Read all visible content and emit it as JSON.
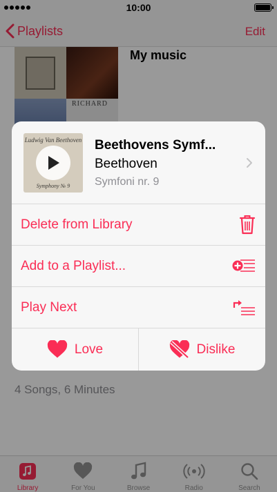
{
  "status_bar": {
    "time": "10:00"
  },
  "nav": {
    "back_label": "Playlists",
    "edit_label": "Edit"
  },
  "playlist": {
    "title": "My music",
    "art_text": "RICHARD",
    "songs_info": "4 Songs, 6 Minutes"
  },
  "sheet": {
    "title": "Beethovens Symf...",
    "artist": "Beethoven",
    "album": "Symfoni nr. 9",
    "actions": {
      "delete": "Delete from Library",
      "add_playlist": "Add to a Playlist...",
      "play_next": "Play Next"
    },
    "love": "Love",
    "dislike": "Dislike"
  },
  "tabs": [
    {
      "label": "Library",
      "icon": "music-note-square-icon",
      "active": true
    },
    {
      "label": "For You",
      "icon": "heart-icon"
    },
    {
      "label": "Browse",
      "icon": "music-note-icon"
    },
    {
      "label": "Radio",
      "icon": "radio-waves-icon"
    },
    {
      "label": "Search",
      "icon": "search-icon"
    }
  ],
  "colors": {
    "accent": "#fa2d55",
    "secondary_text": "#8e8e93"
  }
}
